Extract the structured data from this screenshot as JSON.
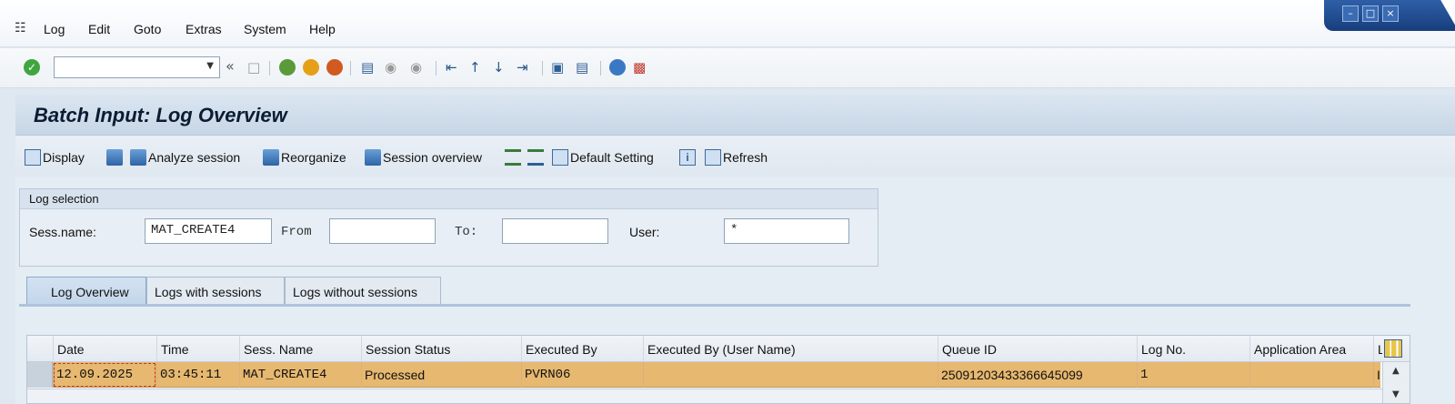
{
  "menubar": {
    "items": [
      "Log",
      "Edit",
      "Goto",
      "Extras",
      "System",
      "Help"
    ]
  },
  "toolbar": {
    "command_value": "",
    "icons": [
      "ok-icon",
      "save-icon",
      "back-icon",
      "exit-icon",
      "cancel-icon",
      "print-icon",
      "find-icon",
      "find-next-icon",
      "first-page-icon",
      "previous-page-icon",
      "next-page-icon",
      "last-page-icon",
      "create-session-icon",
      "generate-shortcut-icon",
      "help-icon",
      "customize-layout-icon"
    ]
  },
  "page": {
    "title": "Batch Input: Log Overview"
  },
  "app_toolbar": {
    "display": "Display",
    "analyze_session": "Analyze session",
    "reorganize": "Reorganize",
    "session_overview": "Session overview",
    "default_setting": "Default Setting",
    "refresh": "Refresh"
  },
  "log_selection": {
    "title": "Log selection",
    "sess_name_label": "Sess.name:",
    "sess_name_value": "MAT_CREATE4",
    "from_label": "From",
    "from_value": "",
    "to_label": "To:",
    "to_value": "",
    "user_label": "User:",
    "user_value": "*"
  },
  "tabs": [
    {
      "label": "Log Overview",
      "active": true
    },
    {
      "label": "Logs with sessions",
      "active": false
    },
    {
      "label": "Logs without sessions",
      "active": false
    }
  ],
  "table": {
    "columns": [
      "Date",
      "Time",
      "Sess. Name",
      "Session Status",
      "Executed By",
      "Executed By (User Name)",
      "Queue ID",
      "Log No.",
      "Application Area",
      "L"
    ],
    "rows": [
      {
        "date": "12.09.2025",
        "time": "03:45:11",
        "sess_name": "MAT_CREATE4",
        "status": "Processed",
        "executed_by": "PVRN06",
        "executed_by_name": "",
        "queue_id": "25091203433366645099",
        "log_no": "1",
        "app_area": "",
        "extra": "I"
      }
    ],
    "selected_row_color": "#e7b870"
  },
  "colors": {
    "accent": "#2f5fa8",
    "title_bar": "#c7d6e6",
    "selected_row": "#e7b870"
  }
}
